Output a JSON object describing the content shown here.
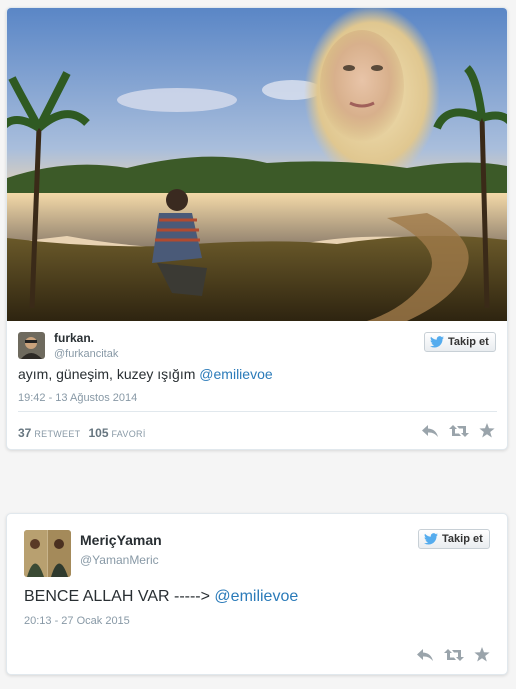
{
  "tweets": [
    {
      "display_name": "furkan.",
      "handle": "@furkancitak",
      "text": "ayım, güneşim, kuzey ışığım",
      "mention": "@emilievoe",
      "timestamp": "19:42 - 13 Ağustos 2014",
      "retweet_count": "37",
      "retweet_label": "RETWEET",
      "favorite_count": "105",
      "favorite_label": "FAVORİ",
      "follow_label": "Takip et",
      "has_photo": true
    },
    {
      "display_name": "MeriçYaman",
      "handle": "@YamanMeric",
      "text": "BENCE ALLAH VAR ----->",
      "mention": "@emilievoe",
      "timestamp": "20:13 - 27 Ocak 2015",
      "follow_label": "Takip et"
    }
  ],
  "colors": {
    "link": "#2b7bb9",
    "muted": "#8899a6",
    "twitter_blue": "#55acee"
  },
  "icons": [
    "twitter-bird-icon",
    "reply-icon",
    "retweet-icon",
    "favorite-star-icon"
  ]
}
